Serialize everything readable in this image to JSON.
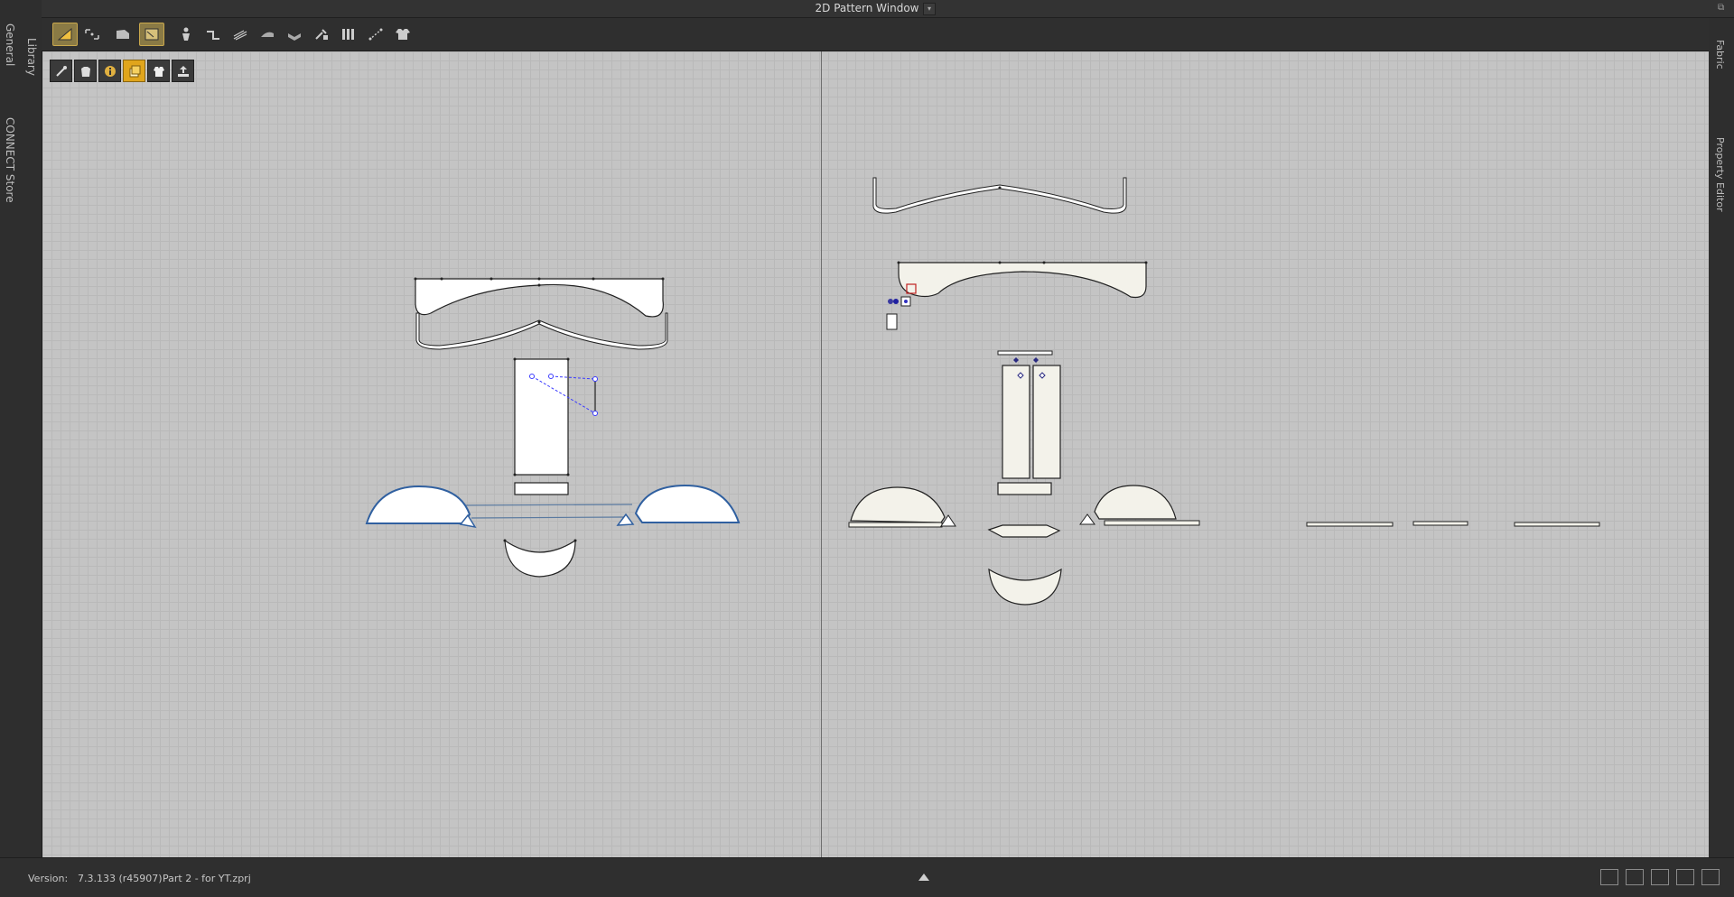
{
  "window": {
    "title": "2D Pattern Window"
  },
  "left_tabs": [
    "Library",
    "General",
    "CONNECT Store"
  ],
  "right_tabs": [
    "Fabric",
    "Property Editor"
  ],
  "toolbar": {
    "tools": [
      "edit-pattern-icon",
      "transform-points-icon",
      "polygon-icon",
      "internal-shape-icon",
      "avatar-icon",
      "segment-sewing-icon",
      "grid-icon",
      "pressing-icon",
      "fold-icon",
      "pin-icon",
      "pleat-icon",
      "measure-icon",
      "garment-icon"
    ],
    "active": [
      0,
      3
    ]
  },
  "subtools": {
    "tools": [
      "show-pattern-icon",
      "show-avatar-icon",
      "info-icon",
      "fill-pattern-icon",
      "shirt-view-icon",
      "upload-icon"
    ],
    "active": [
      3
    ]
  },
  "status": {
    "version_label": "Version:",
    "version_value": "7.3.133 (r45907)",
    "project": "Part 2 - for YT.zprj"
  }
}
